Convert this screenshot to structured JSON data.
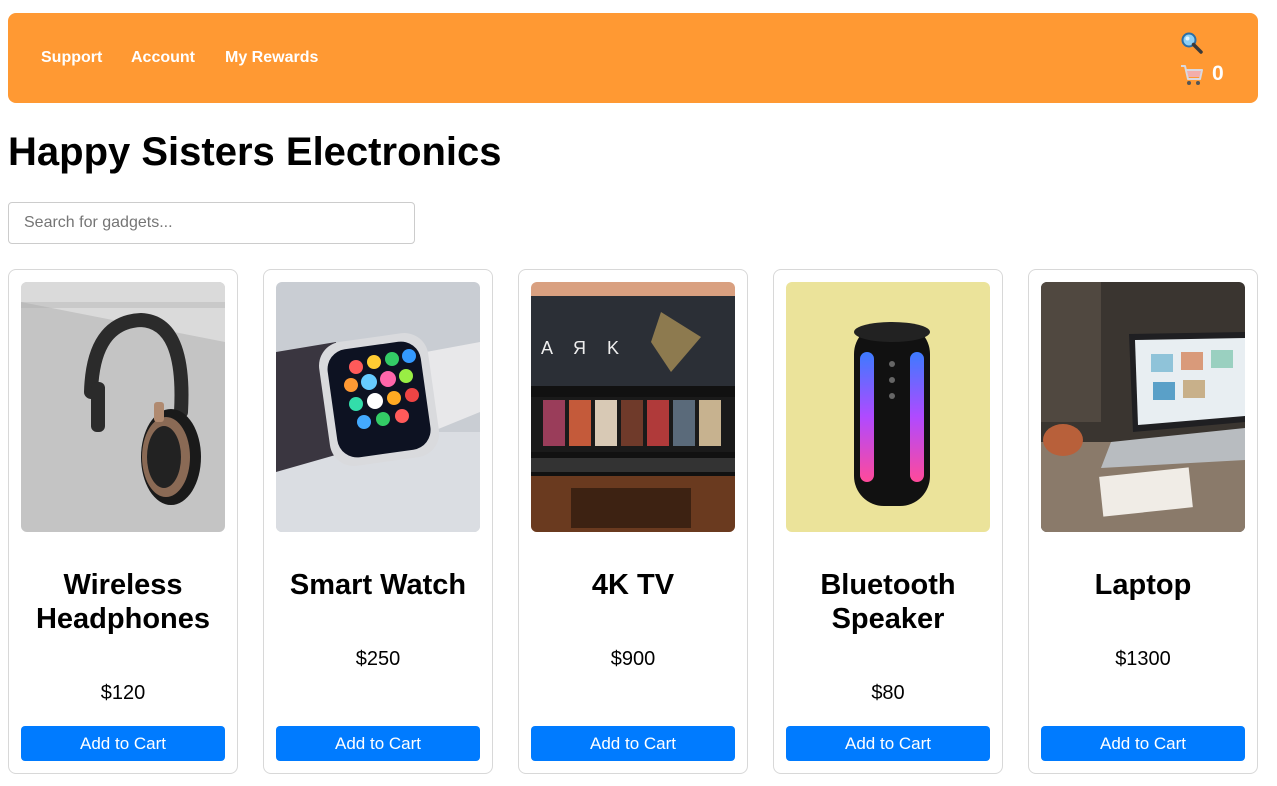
{
  "nav": {
    "links": [
      "Support",
      "Account",
      "My Rewards"
    ],
    "search_icon": "magnifier-icon",
    "cart_icon": "shopping-cart-icon",
    "cart_count": "0",
    "background": "#ff9933"
  },
  "page_title": "Happy Sisters Electronics",
  "search": {
    "placeholder": "Search for gadgets...",
    "value": ""
  },
  "products": [
    {
      "name": "Wireless Headphones",
      "price": "$120",
      "button": "Add to Cart",
      "image": "headphones-photo"
    },
    {
      "name": "Smart Watch",
      "price": "$250",
      "button": "Add to Cart",
      "image": "smartwatch-photo"
    },
    {
      "name": "4K TV",
      "price": "$900",
      "button": "Add to Cart",
      "image": "television-photo"
    },
    {
      "name": "Bluetooth Speaker",
      "price": "$80",
      "button": "Add to Cart",
      "image": "speaker-photo"
    },
    {
      "name": "Laptop",
      "price": "$1300",
      "button": "Add to Cart",
      "image": "laptop-photo"
    }
  ],
  "colors": {
    "accent": "#ff9933",
    "button": "#007bff",
    "text": "#000000"
  }
}
